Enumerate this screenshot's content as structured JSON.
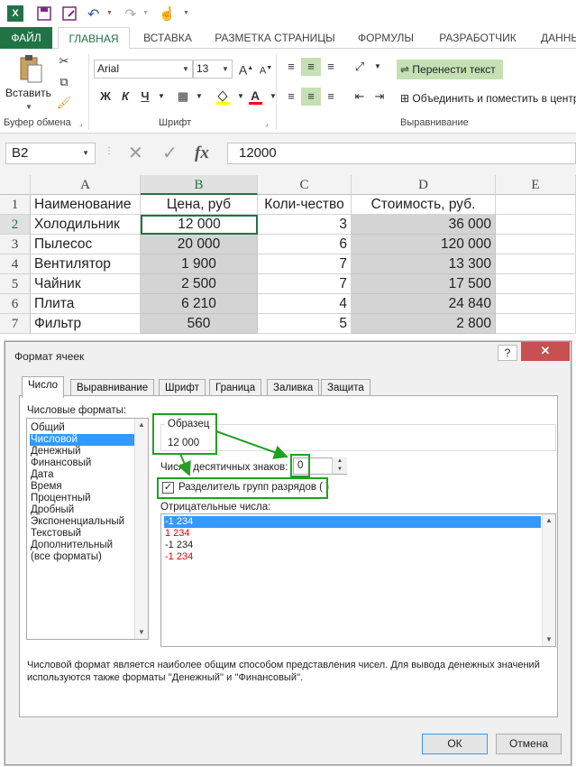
{
  "ribbon": {
    "tabs": [
      "ФАЙЛ",
      "ГЛАВНАЯ",
      "ВСТАВКА",
      "РАЗМЕТКА СТРАНИЦЫ",
      "ФОРМУЛЫ",
      "РАЗРАБОТЧИК",
      "ДАННЫ"
    ],
    "paste_label": "Вставить",
    "font_name": "Arial",
    "font_size": "13",
    "bold": "Ж",
    "italic": "К",
    "underline": "Ч",
    "wrap_text": "Перенести текст",
    "merge_center": "Объединить и поместить в центр",
    "groups": {
      "clipboard": "Буфер обмена",
      "font": "Шрифт",
      "alignment": "Выравнивание"
    }
  },
  "formula_bar": {
    "name_box": "B2",
    "fx": "fx",
    "value": "12000"
  },
  "sheet": {
    "columns": [
      "A",
      "B",
      "C",
      "D",
      "E"
    ],
    "rows": [
      "1",
      "2",
      "3",
      "4",
      "5",
      "6",
      "7"
    ],
    "header": [
      "Наименование",
      "Цена, руб",
      "Коли-чество",
      "Стоимость, руб."
    ],
    "data": [
      [
        "Холодильник",
        "12 000",
        "3",
        "36 000"
      ],
      [
        "Пылесос",
        "20 000",
        "6",
        "120 000"
      ],
      [
        "Вентилятор",
        "1 900",
        "7",
        "13 300"
      ],
      [
        "Чайник",
        "2 500",
        "7",
        "17 500"
      ],
      [
        "Плита",
        "6 210",
        "4",
        "24 840"
      ],
      [
        "Фильтр",
        "560",
        "5",
        "2 800"
      ]
    ]
  },
  "dialog": {
    "title": "Формат ячеек",
    "help": "?",
    "close": "✕",
    "tabs": [
      "Число",
      "Выравнивание",
      "Шрифт",
      "Граница",
      "Заливка",
      "Защита"
    ],
    "formats_label": "Числовые форматы:",
    "formats": [
      "Общий",
      "Числовой",
      "Денежный",
      "Финансовый",
      "Дата",
      "Время",
      "Процентный",
      "Дробный",
      "Экспоненциальный",
      "Текстовый",
      "Дополнительный",
      "(все форматы)"
    ],
    "selected_format": "Числовой",
    "sample_label": "Образец",
    "sample_value": "12 000",
    "decimals_label": "Число десятичных знаков:",
    "decimals_value": "0",
    "separator_label": "Разделитель групп разрядов ( )",
    "separator_checked": "✓",
    "negative_label": "Отрицательные числа:",
    "negatives": [
      {
        "text": "-1 234",
        "color": "#ffffff"
      },
      {
        "text": "1 234",
        "color": "#e00000"
      },
      {
        "text": "-1 234",
        "color": "#000000"
      },
      {
        "text": "-1 234",
        "color": "#e00000"
      }
    ],
    "description": "Числовой формат является наиболее общим способом представления чисел. Для вывода денежных значений используются также форматы ''Денежный'' и ''Финансовый''.",
    "ok": "ОК",
    "cancel": "Отмена"
  },
  "colors": {
    "excel_green": "#217346",
    "highlight_green": "#22a022",
    "selection_blue": "#3399ff"
  }
}
